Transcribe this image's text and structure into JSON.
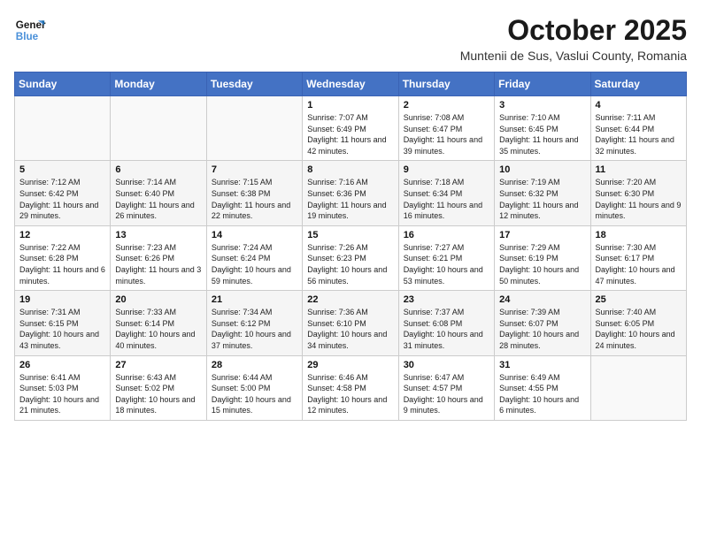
{
  "logo": {
    "line1": "General",
    "line2": "Blue"
  },
  "title": "October 2025",
  "subtitle": "Muntenii de Sus, Vaslui County, Romania",
  "weekdays": [
    "Sunday",
    "Monday",
    "Tuesday",
    "Wednesday",
    "Thursday",
    "Friday",
    "Saturday"
  ],
  "weeks": [
    [
      {
        "day": "",
        "sunrise": "",
        "sunset": "",
        "daylight": ""
      },
      {
        "day": "",
        "sunrise": "",
        "sunset": "",
        "daylight": ""
      },
      {
        "day": "",
        "sunrise": "",
        "sunset": "",
        "daylight": ""
      },
      {
        "day": "1",
        "sunrise": "Sunrise: 7:07 AM",
        "sunset": "Sunset: 6:49 PM",
        "daylight": "Daylight: 11 hours and 42 minutes."
      },
      {
        "day": "2",
        "sunrise": "Sunrise: 7:08 AM",
        "sunset": "Sunset: 6:47 PM",
        "daylight": "Daylight: 11 hours and 39 minutes."
      },
      {
        "day": "3",
        "sunrise": "Sunrise: 7:10 AM",
        "sunset": "Sunset: 6:45 PM",
        "daylight": "Daylight: 11 hours and 35 minutes."
      },
      {
        "day": "4",
        "sunrise": "Sunrise: 7:11 AM",
        "sunset": "Sunset: 6:44 PM",
        "daylight": "Daylight: 11 hours and 32 minutes."
      }
    ],
    [
      {
        "day": "5",
        "sunrise": "Sunrise: 7:12 AM",
        "sunset": "Sunset: 6:42 PM",
        "daylight": "Daylight: 11 hours and 29 minutes."
      },
      {
        "day": "6",
        "sunrise": "Sunrise: 7:14 AM",
        "sunset": "Sunset: 6:40 PM",
        "daylight": "Daylight: 11 hours and 26 minutes."
      },
      {
        "day": "7",
        "sunrise": "Sunrise: 7:15 AM",
        "sunset": "Sunset: 6:38 PM",
        "daylight": "Daylight: 11 hours and 22 minutes."
      },
      {
        "day": "8",
        "sunrise": "Sunrise: 7:16 AM",
        "sunset": "Sunset: 6:36 PM",
        "daylight": "Daylight: 11 hours and 19 minutes."
      },
      {
        "day": "9",
        "sunrise": "Sunrise: 7:18 AM",
        "sunset": "Sunset: 6:34 PM",
        "daylight": "Daylight: 11 hours and 16 minutes."
      },
      {
        "day": "10",
        "sunrise": "Sunrise: 7:19 AM",
        "sunset": "Sunset: 6:32 PM",
        "daylight": "Daylight: 11 hours and 12 minutes."
      },
      {
        "day": "11",
        "sunrise": "Sunrise: 7:20 AM",
        "sunset": "Sunset: 6:30 PM",
        "daylight": "Daylight: 11 hours and 9 minutes."
      }
    ],
    [
      {
        "day": "12",
        "sunrise": "Sunrise: 7:22 AM",
        "sunset": "Sunset: 6:28 PM",
        "daylight": "Daylight: 11 hours and 6 minutes."
      },
      {
        "day": "13",
        "sunrise": "Sunrise: 7:23 AM",
        "sunset": "Sunset: 6:26 PM",
        "daylight": "Daylight: 11 hours and 3 minutes."
      },
      {
        "day": "14",
        "sunrise": "Sunrise: 7:24 AM",
        "sunset": "Sunset: 6:24 PM",
        "daylight": "Daylight: 10 hours and 59 minutes."
      },
      {
        "day": "15",
        "sunrise": "Sunrise: 7:26 AM",
        "sunset": "Sunset: 6:23 PM",
        "daylight": "Daylight: 10 hours and 56 minutes."
      },
      {
        "day": "16",
        "sunrise": "Sunrise: 7:27 AM",
        "sunset": "Sunset: 6:21 PM",
        "daylight": "Daylight: 10 hours and 53 minutes."
      },
      {
        "day": "17",
        "sunrise": "Sunrise: 7:29 AM",
        "sunset": "Sunset: 6:19 PM",
        "daylight": "Daylight: 10 hours and 50 minutes."
      },
      {
        "day": "18",
        "sunrise": "Sunrise: 7:30 AM",
        "sunset": "Sunset: 6:17 PM",
        "daylight": "Daylight: 10 hours and 47 minutes."
      }
    ],
    [
      {
        "day": "19",
        "sunrise": "Sunrise: 7:31 AM",
        "sunset": "Sunset: 6:15 PM",
        "daylight": "Daylight: 10 hours and 43 minutes."
      },
      {
        "day": "20",
        "sunrise": "Sunrise: 7:33 AM",
        "sunset": "Sunset: 6:14 PM",
        "daylight": "Daylight: 10 hours and 40 minutes."
      },
      {
        "day": "21",
        "sunrise": "Sunrise: 7:34 AM",
        "sunset": "Sunset: 6:12 PM",
        "daylight": "Daylight: 10 hours and 37 minutes."
      },
      {
        "day": "22",
        "sunrise": "Sunrise: 7:36 AM",
        "sunset": "Sunset: 6:10 PM",
        "daylight": "Daylight: 10 hours and 34 minutes."
      },
      {
        "day": "23",
        "sunrise": "Sunrise: 7:37 AM",
        "sunset": "Sunset: 6:08 PM",
        "daylight": "Daylight: 10 hours and 31 minutes."
      },
      {
        "day": "24",
        "sunrise": "Sunrise: 7:39 AM",
        "sunset": "Sunset: 6:07 PM",
        "daylight": "Daylight: 10 hours and 28 minutes."
      },
      {
        "day": "25",
        "sunrise": "Sunrise: 7:40 AM",
        "sunset": "Sunset: 6:05 PM",
        "daylight": "Daylight: 10 hours and 24 minutes."
      }
    ],
    [
      {
        "day": "26",
        "sunrise": "Sunrise: 6:41 AM",
        "sunset": "Sunset: 5:03 PM",
        "daylight": "Daylight: 10 hours and 21 minutes."
      },
      {
        "day": "27",
        "sunrise": "Sunrise: 6:43 AM",
        "sunset": "Sunset: 5:02 PM",
        "daylight": "Daylight: 10 hours and 18 minutes."
      },
      {
        "day": "28",
        "sunrise": "Sunrise: 6:44 AM",
        "sunset": "Sunset: 5:00 PM",
        "daylight": "Daylight: 10 hours and 15 minutes."
      },
      {
        "day": "29",
        "sunrise": "Sunrise: 6:46 AM",
        "sunset": "Sunset: 4:58 PM",
        "daylight": "Daylight: 10 hours and 12 minutes."
      },
      {
        "day": "30",
        "sunrise": "Sunrise: 6:47 AM",
        "sunset": "Sunset: 4:57 PM",
        "daylight": "Daylight: 10 hours and 9 minutes."
      },
      {
        "day": "31",
        "sunrise": "Sunrise: 6:49 AM",
        "sunset": "Sunset: 4:55 PM",
        "daylight": "Daylight: 10 hours and 6 minutes."
      },
      {
        "day": "",
        "sunrise": "",
        "sunset": "",
        "daylight": ""
      }
    ]
  ]
}
